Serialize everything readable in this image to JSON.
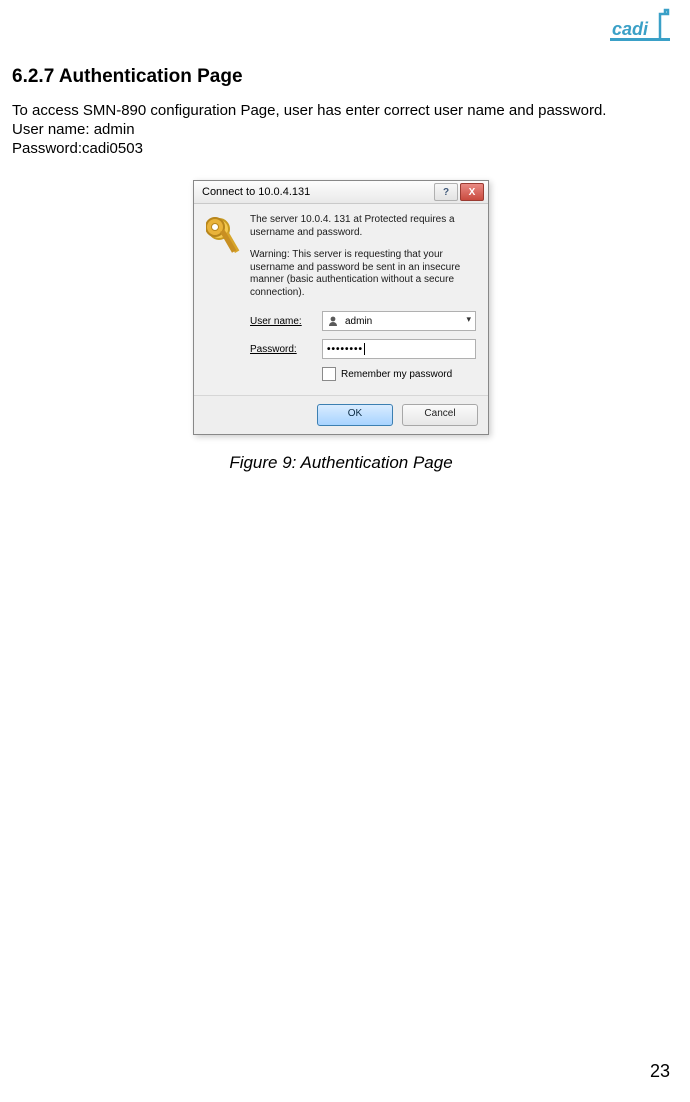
{
  "logo_text": "cadi",
  "section_heading": "6.2.7 Authentication Page",
  "intro_text": "To access SMN-890 configuration Page, user has enter correct user name and password.",
  "cred_user_line": "User name: admin",
  "cred_pass_line": "Password:cadi0503",
  "dialog": {
    "title": "Connect to 10.0.4.131",
    "server_msg": "The server 10.0.4. 131 at Protected requires a username and password.",
    "warn_msg": "Warning: This server is requesting that your username and password be sent in an insecure manner (basic authentication without a secure connection).",
    "label_user": "User name:",
    "label_pass": "Password:",
    "value_user": "admin",
    "value_pass": "••••••••",
    "remember": "Remember my password",
    "ok": "OK",
    "cancel": "Cancel",
    "help": "?",
    "close": "X"
  },
  "caption": "Figure 9: Authentication Page",
  "page_number": "23"
}
